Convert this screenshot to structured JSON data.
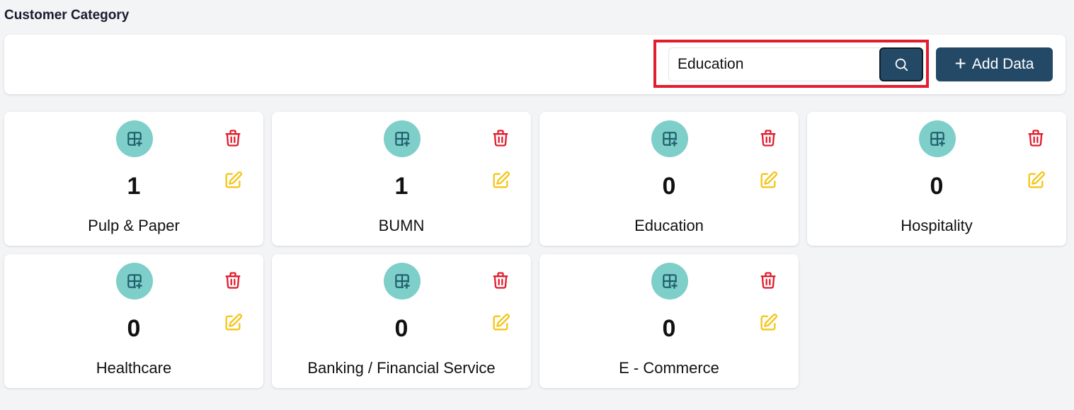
{
  "page": {
    "title": "Customer Category"
  },
  "toolbar": {
    "search_value": "Education",
    "search_icon": "search-icon",
    "add_label": "Add Data",
    "add_icon": "plus-icon"
  },
  "colors": {
    "primary": "#234966",
    "icon_circle": "#7ecfca",
    "delete": "#e11d2e",
    "edit": "#f5c518",
    "highlight": "#e11d2e"
  },
  "categories": [
    {
      "name": "Pulp & Paper",
      "count": "1"
    },
    {
      "name": "BUMN",
      "count": "1"
    },
    {
      "name": "Education",
      "count": "0"
    },
    {
      "name": "Hospitality",
      "count": "0"
    },
    {
      "name": "Healthcare",
      "count": "0"
    },
    {
      "name": "Banking / Financial Service",
      "count": "0"
    },
    {
      "name": "E - Commerce",
      "count": "0"
    }
  ]
}
